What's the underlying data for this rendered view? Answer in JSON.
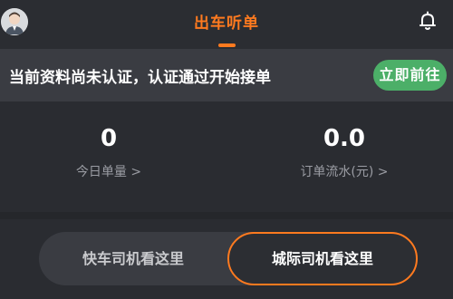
{
  "header": {
    "title": "出车听单",
    "avatar_icon": "user-avatar-icon",
    "bell_icon": "bell-icon",
    "accent_color": "#ff7a1f"
  },
  "notice": {
    "text": "当前资料尚未认证，认证通过开始接单",
    "button_label": "立即前往",
    "button_color": "#4caf68"
  },
  "stats": [
    {
      "value": "0",
      "label": "今日单量 >"
    },
    {
      "value": "0.0",
      "label": "订单流水(元) >"
    }
  ],
  "toggle": {
    "options": [
      "快车司机看这里",
      "城际司机看这里"
    ],
    "selected": "城际司机看这里"
  }
}
